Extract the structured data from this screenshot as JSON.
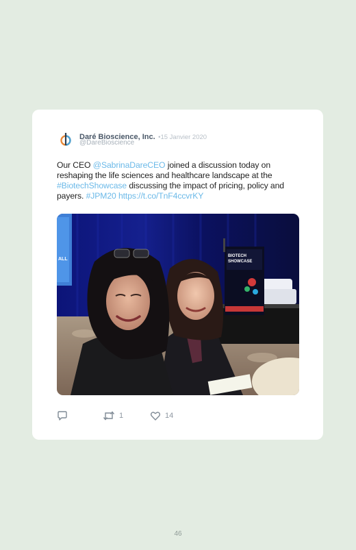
{
  "tweet": {
    "author_name": "Daré Bioscience, Inc.",
    "date": "15 Janvier 2020",
    "date_separator": "•",
    "handle": "@DareBioscience",
    "text_segments": [
      {
        "text": "Our CEO ",
        "link": false
      },
      {
        "text": "@SabrinaDareCEO",
        "link": true
      },
      {
        "text": " joined a discussion today on reshaping the life sciences and healthcare landscape at the ",
        "link": false
      },
      {
        "text": "#BiotechShowcase",
        "link": true
      },
      {
        "text": " discussing the impact of pricing, policy and payers. ",
        "link": false
      },
      {
        "text": "#JPM20",
        "link": true
      },
      {
        "text": " ",
        "link": false
      },
      {
        "text": "https://t.co/TnF4ccvrKY",
        "link": true
      }
    ],
    "photo_sign_text": "BIOTECH SHOWCASE",
    "reply_count": "",
    "retweet_count": "1",
    "like_count": "14"
  },
  "footer": {
    "page_number": "46"
  },
  "colors": {
    "background": "#e3ece2",
    "card": "#ffffff",
    "link": "#6bb9e8",
    "icon": "#7f8a95"
  },
  "icons": {
    "avatar": "dare-logo-icon",
    "reply": "reply-icon",
    "retweet": "retweet-icon",
    "like": "heart-icon"
  }
}
